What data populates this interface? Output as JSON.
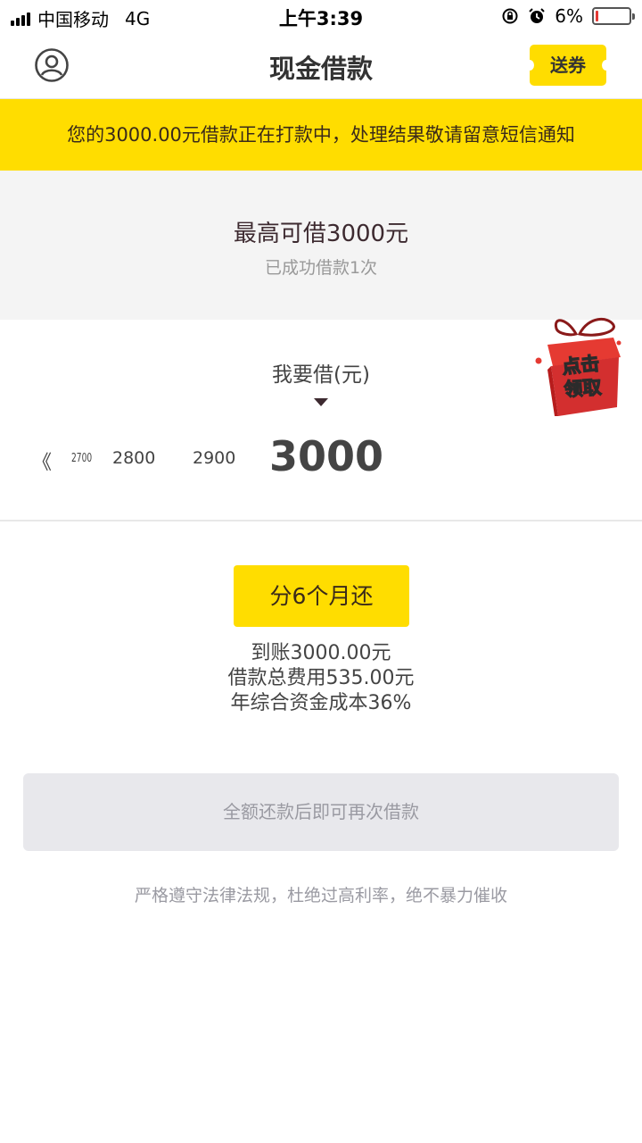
{
  "status_bar": {
    "carrier": "中国移动",
    "network": "4G",
    "time": "上午3:39",
    "battery_percent": "6%",
    "battery_level": 0.06,
    "icons": [
      "signal-icon",
      "rotation-lock-icon",
      "alarm-icon",
      "battery-icon"
    ]
  },
  "nav": {
    "title": "现金借款",
    "coupon_label": "送券",
    "avatar_icon": "user-profile-icon"
  },
  "notice": {
    "text": "您的3000.00元借款正在打款中，处理结果敬请留意短信通知"
  },
  "limit": {
    "title": "最高可借3000元",
    "subtitle": "已成功借款1次"
  },
  "picker": {
    "label": "我要借(元)",
    "left_chevron": "《",
    "scale_values": [
      "2700",
      "2800",
      "2900"
    ],
    "selected_value": "3000"
  },
  "gift": {
    "text": "点击领取"
  },
  "plan": {
    "button_label": "分6个月还",
    "info": [
      "到账3000.00元",
      "借款总费用535.00元",
      "年综合资金成本36%"
    ]
  },
  "action": {
    "button_label": "全额还款后即可再次借款"
  },
  "footer": {
    "note": "严格遵守法律法规，杜绝过高利率，绝不暴力催收"
  },
  "colors": {
    "accent_yellow": "#ffdd00",
    "text_dark": "#3d2a30",
    "muted": "#9a9aa2",
    "gift_red": "#e53a32"
  }
}
